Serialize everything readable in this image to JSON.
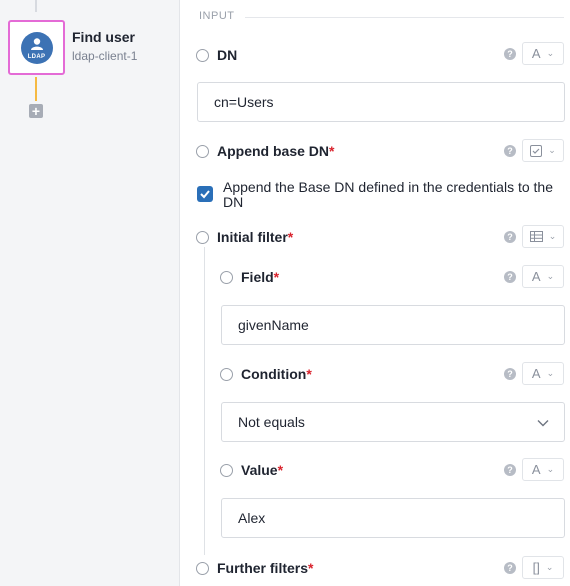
{
  "node": {
    "title": "Find user",
    "subtitle": "ldap-client-1",
    "icon": "ldap-icon",
    "icon_text": "LDAP",
    "border_color": "#e46bd6",
    "icon_color": "#3c72b4",
    "connector_color": "#f5b942"
  },
  "section": {
    "label": "INPUT"
  },
  "fields": {
    "dn": {
      "label": "DN",
      "type_icon": "A",
      "value": "cn=Users"
    },
    "append_base_dn": {
      "label": "Append base DN",
      "required": "*",
      "type_icon": "checkbox-icon",
      "checkbox_label": "Append the Base DN defined in the credentials to the DN",
      "checked": true
    },
    "initial_filter": {
      "label": "Initial filter",
      "required": "*",
      "type_icon": "table-icon",
      "field": {
        "label": "Field",
        "required": "*",
        "type_icon": "A",
        "value": "givenName"
      },
      "condition": {
        "label": "Condition",
        "required": "*",
        "type_icon": "A",
        "value": "Not equals"
      },
      "value": {
        "label": "Value",
        "required": "*",
        "type_icon": "A",
        "value": "Alex"
      }
    },
    "further_filters": {
      "label": "Further filters",
      "required": "*",
      "type_icon": "[]"
    }
  },
  "help_glyph": "?",
  "add_glyph": "+"
}
